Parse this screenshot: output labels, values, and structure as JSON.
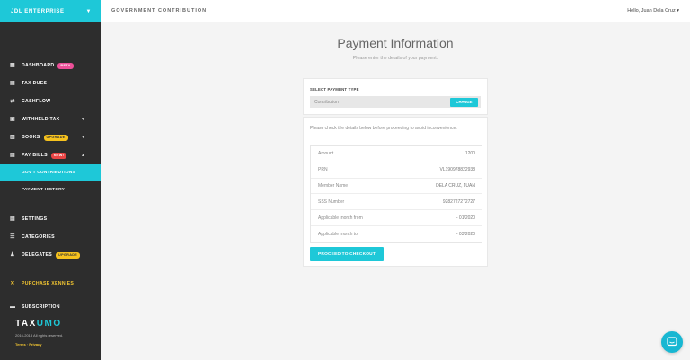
{
  "sidebar": {
    "brand": "JDL ENTERPRISE",
    "items": [
      {
        "label": "DASHBOARD",
        "icon": "dashboard-icon",
        "badge": "BETA"
      },
      {
        "label": "TAX DUES",
        "icon": "tax-icon"
      },
      {
        "label": "CASHFLOW",
        "icon": "cashflow-icon"
      },
      {
        "label": "WITHHELD TAX",
        "icon": "withheld-icon"
      },
      {
        "label": "BOOKS",
        "icon": "books-icon",
        "badge": "UPGRADE"
      },
      {
        "label": "PAY BILLS",
        "icon": "paybills-icon",
        "badge": "NEW!"
      }
    ],
    "sub_items": [
      "GOV'T CONTRIBUTIONS",
      "PAYMENT HISTORY"
    ],
    "items2": [
      {
        "label": "SETTINGS",
        "icon": "settings-icon"
      },
      {
        "label": "CATEGORIES",
        "icon": "categories-icon"
      },
      {
        "label": "DELEGATES",
        "icon": "delegates-icon",
        "badge": "UPGRADE"
      },
      {
        "label": "PURCHASE XENNIES",
        "icon": "purchase-icon"
      },
      {
        "label": "SUBSCRIPTION",
        "icon": "subscription-icon"
      }
    ],
    "logo_a": "TAX",
    "logo_b": "UMO",
    "copyright": "2016-2018 All rights reserved.",
    "footer_links": "Terms · Privacy"
  },
  "topbar": {
    "title": "GOVERNMENT CONTRIBUTION",
    "user": "Hello, Juan Dela Cruz ▾"
  },
  "main": {
    "heading": "Payment Information",
    "subheading": "Please enter the details of your payment.",
    "select_label": "SELECT PAYMENT TYPE",
    "select_value": "Contribution",
    "change_label": "CHANGE",
    "note": "Please check the details below before proceeding to avoid inconvenience.",
    "details": [
      {
        "k": "Amount",
        "v": "1200"
      },
      {
        "k": "PRN",
        "v": "VL190978822938"
      },
      {
        "k": "Member Name",
        "v": "DELA CRUZ, JUAN"
      },
      {
        "k": "SSS Number",
        "v": "9282727272727"
      },
      {
        "k": "Applicable month from",
        "v": "- 01/2020"
      },
      {
        "k": "Applicable month to",
        "v": "- 03/2020"
      }
    ],
    "checkout_label": "PROCEED TO CHECKOUT"
  },
  "colors": {
    "accent": "#1ec8d8",
    "sidebar": "#2d2d2d",
    "beta": "#ec4f98",
    "upgrade": "#f6c21e",
    "new": "#e94545"
  }
}
